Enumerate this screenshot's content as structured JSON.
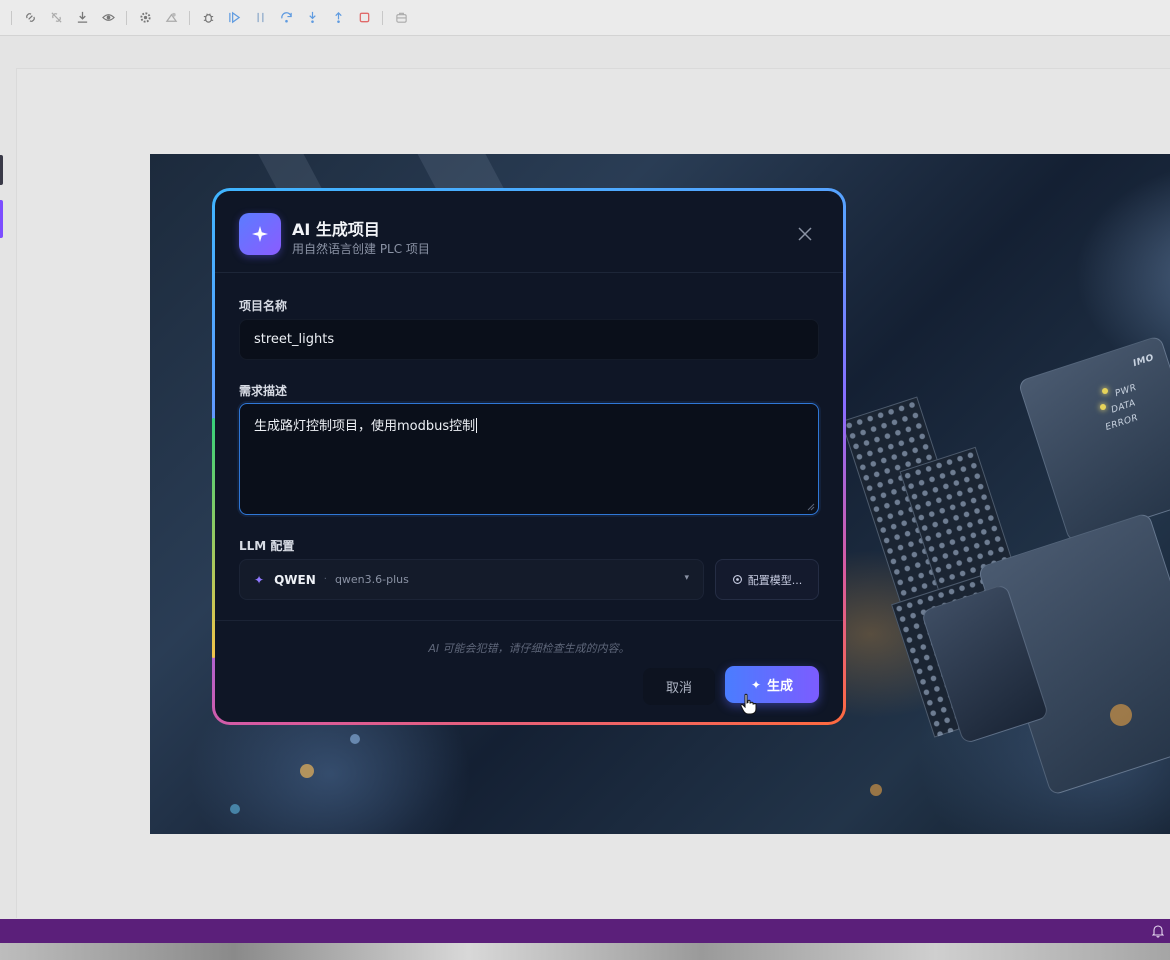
{
  "toolbar": {
    "icons": [
      "link-icon",
      "unlink-icon",
      "download-icon",
      "watch-icon",
      "settings-icon",
      "deploy-icon",
      "debug-icon",
      "run-icon",
      "pause-icon",
      "step-over-icon",
      "step-into-icon",
      "step-out-icon",
      "stop-icon",
      "bag-icon"
    ]
  },
  "dialog": {
    "title": "AI 生成项目",
    "subtitle": "用自然语言创建 PLC 项目",
    "project_name_label": "项目名称",
    "project_name_value": "street_lights",
    "requirement_label": "需求描述",
    "requirement_value": "生成路灯控制项目，使用modbus控制",
    "llm_label": "LLM 配置",
    "llm_provider": "QWEN",
    "llm_separator": "·",
    "llm_model": "qwen3.6-plus",
    "configure_model_label": "配置模型...",
    "disclaimer": "AI 可能会犯错，请仔细检查生成的内容。",
    "cancel_label": "取消",
    "generate_label": "生成"
  },
  "hero_image": {
    "led_labels": [
      "PWR",
      "DATA",
      "ERROR"
    ],
    "module_label": "IMO"
  },
  "colors": {
    "accent": "#6a6cff",
    "dialog_bg": "#0f1626",
    "statusbar": "#5b1f7a",
    "focus_border": "#2f77d6"
  }
}
